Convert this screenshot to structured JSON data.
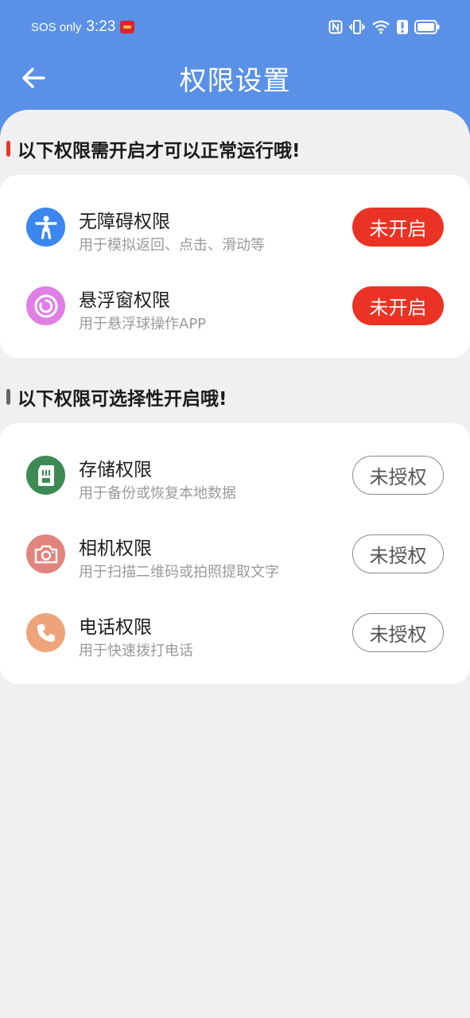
{
  "status_bar": {
    "carrier": "SOS only",
    "time": "3:23"
  },
  "header": {
    "title": "权限设置"
  },
  "required_section": {
    "title": "以下权限需开启才可以正常运行哦!",
    "accent_color": "#e8352a",
    "items": [
      {
        "title": "无障碍权限",
        "desc": "用于模拟返回、点击、滑动等",
        "status": "未开启",
        "icon": "accessibility-icon",
        "icon_color": "#3b86ef"
      },
      {
        "title": "悬浮窗权限",
        "desc": "用于悬浮球操作APP",
        "status": "未开启",
        "icon": "floating-window-icon",
        "icon_color": "#df7fe6"
      }
    ]
  },
  "optional_section": {
    "title": "以下权限可选择性开启哦!",
    "accent_color": "#666666",
    "items": [
      {
        "title": "存储权限",
        "desc": "用于备份或恢复本地数据",
        "status": "未授权",
        "icon": "storage-icon",
        "icon_color": "#3d8a54"
      },
      {
        "title": "相机权限",
        "desc": "用于扫描二维码或拍照提取文字",
        "status": "未授权",
        "icon": "camera-icon",
        "icon_color": "#e0857e"
      },
      {
        "title": "电话权限",
        "desc": "用于快速拨打电话",
        "status": "未授权",
        "icon": "phone-icon",
        "icon_color": "#eea47a"
      }
    ]
  },
  "colors": {
    "header_bg": "#5a91e6",
    "page_bg": "#f0f0f2",
    "button_red": "#ea3324"
  }
}
